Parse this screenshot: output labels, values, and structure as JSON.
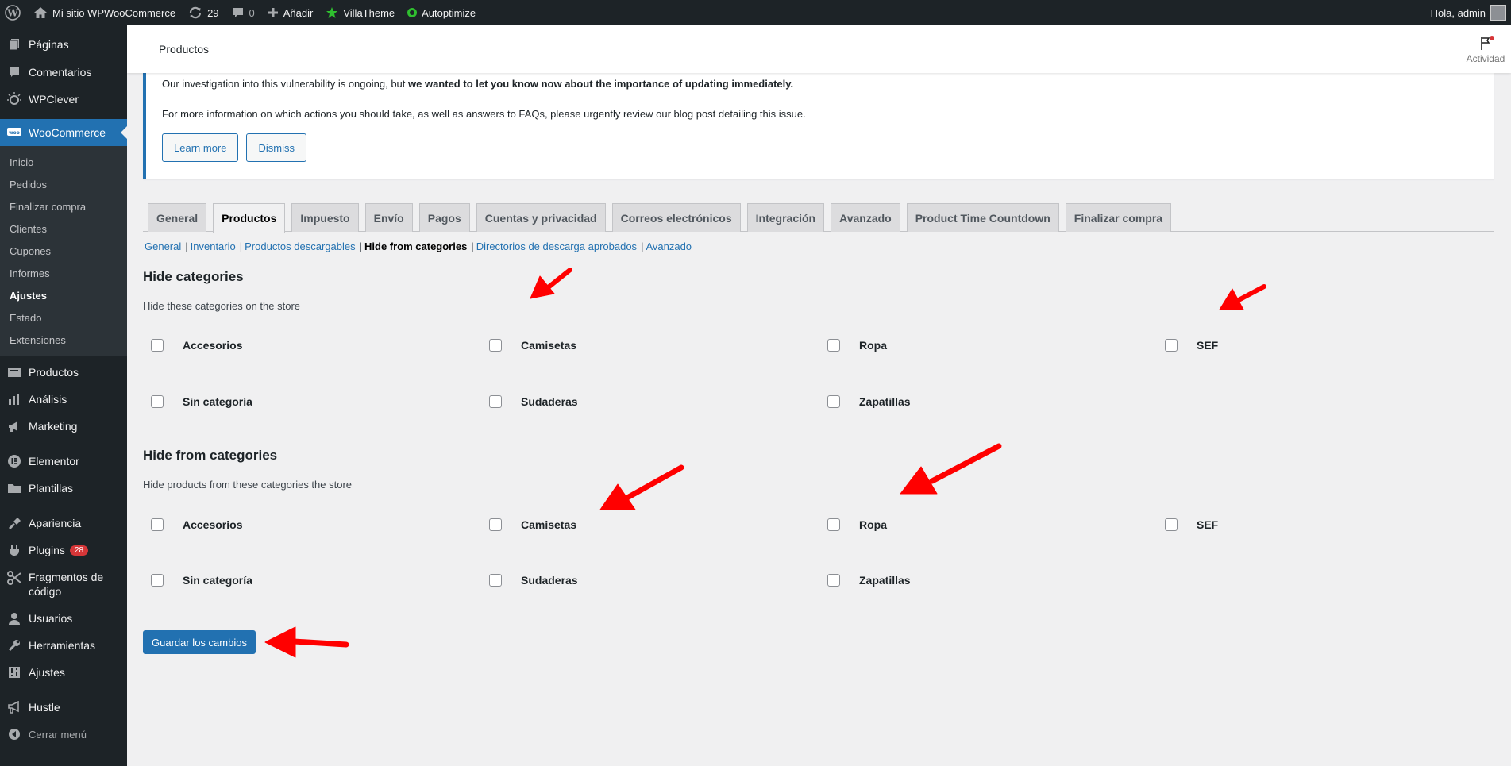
{
  "adminbar": {
    "site_name": "Mi sitio WPWooCommerce",
    "updates_count": "29",
    "comments_count": "0",
    "add_label": "Añadir",
    "villatheme_label": "VillaTheme",
    "autoptimize_label": "Autoptimize",
    "greeting": "Hola, admin",
    "colors": {
      "bg": "#1d2327",
      "villatheme_star": "#2fbf2f",
      "autoptimize_dot": "#2fbf2f"
    }
  },
  "sidebar": {
    "items_top": [
      {
        "label": "Páginas",
        "icon": "pages-icon"
      },
      {
        "label": "Comentarios",
        "icon": "comments-icon"
      },
      {
        "label": "WPClever",
        "icon": "wpclever-icon"
      }
    ],
    "woocommerce": {
      "label": "WooCommerce",
      "icon": "woocommerce-icon"
    },
    "submenu": [
      {
        "label": "Inicio",
        "active": false
      },
      {
        "label": "Pedidos",
        "active": false
      },
      {
        "label": "Finalizar compra",
        "active": false
      },
      {
        "label": "Clientes",
        "active": false
      },
      {
        "label": "Cupones",
        "active": false
      },
      {
        "label": "Informes",
        "active": false
      },
      {
        "label": "Ajustes",
        "active": true
      },
      {
        "label": "Estado",
        "active": false
      },
      {
        "label": "Extensiones",
        "active": false
      }
    ],
    "items_bottom": [
      {
        "label": "Productos",
        "icon": "products-icon"
      },
      {
        "label": "Análisis",
        "icon": "analytics-icon"
      },
      {
        "label": "Marketing",
        "icon": "marketing-icon"
      },
      {
        "label": "Elementor",
        "icon": "elementor-icon"
      },
      {
        "label": "Plantillas",
        "icon": "templates-icon"
      },
      {
        "label": "Apariencia",
        "icon": "appearance-icon"
      },
      {
        "label": "Plugins",
        "icon": "plugins-icon",
        "badge": "28"
      },
      {
        "label_line1": "Fragmentos de",
        "label_line2": "código",
        "icon": "snippets-icon"
      },
      {
        "label": "Usuarios",
        "icon": "users-icon"
      },
      {
        "label": "Herramientas",
        "icon": "tools-icon"
      },
      {
        "label": "Ajustes",
        "icon": "settings-icon"
      },
      {
        "label": "Hustle",
        "icon": "hustle-icon"
      },
      {
        "label": "Cerrar menú",
        "icon": "collapse-menu-icon"
      }
    ]
  },
  "header": {
    "title": "Productos",
    "activity_label": "Actividad"
  },
  "notice": {
    "line1_prefix": "Our investigation into this vulnerability is ongoing, but ",
    "line1_bold": "we wanted to let you know now about the importance of updating immediately.",
    "line2": "For more information on which actions you should take, as well as answers to FAQs, please urgently review our blog post detailing this issue.",
    "learn_more": "Learn more",
    "dismiss": "Dismiss"
  },
  "tabs": [
    {
      "label": "General",
      "active": false
    },
    {
      "label": "Productos",
      "active": true
    },
    {
      "label": "Impuesto",
      "active": false
    },
    {
      "label": "Envío",
      "active": false
    },
    {
      "label": "Pagos",
      "active": false
    },
    {
      "label": "Cuentas y privacidad",
      "active": false
    },
    {
      "label": "Correos electrónicos",
      "active": false
    },
    {
      "label": "Integración",
      "active": false
    },
    {
      "label": "Avanzado",
      "active": false
    },
    {
      "label": "Product Time Countdown",
      "active": false
    },
    {
      "label": "Finalizar compra",
      "active": false
    }
  ],
  "subnav": [
    {
      "label": "General",
      "current": false
    },
    {
      "label": "Inventario",
      "current": false
    },
    {
      "label": "Productos descargables",
      "current": false
    },
    {
      "label": "Hide from categories",
      "current": true
    },
    {
      "label": "Directorios de descarga aprobados",
      "current": false
    },
    {
      "label": "Avanzado",
      "current": false
    }
  ],
  "section1": {
    "title": "Hide categories",
    "description": "Hide these categories on the store",
    "categories": [
      "Accesorios",
      "Camisetas",
      "Ropa",
      "SEF",
      "Sin categoría",
      "Sudaderas",
      "Zapatillas"
    ]
  },
  "section2": {
    "title": "Hide from categories",
    "description": "Hide products from these categories the store",
    "categories": [
      "Accesorios",
      "Camisetas",
      "Ropa",
      "SEF",
      "Sin categoría",
      "Sudaderas",
      "Zapatillas"
    ]
  },
  "save_button": "Guardar los cambios",
  "colors": {
    "accent": "#2271b1",
    "annotation_arrow": "#ff0000",
    "badge": "#d63638"
  }
}
